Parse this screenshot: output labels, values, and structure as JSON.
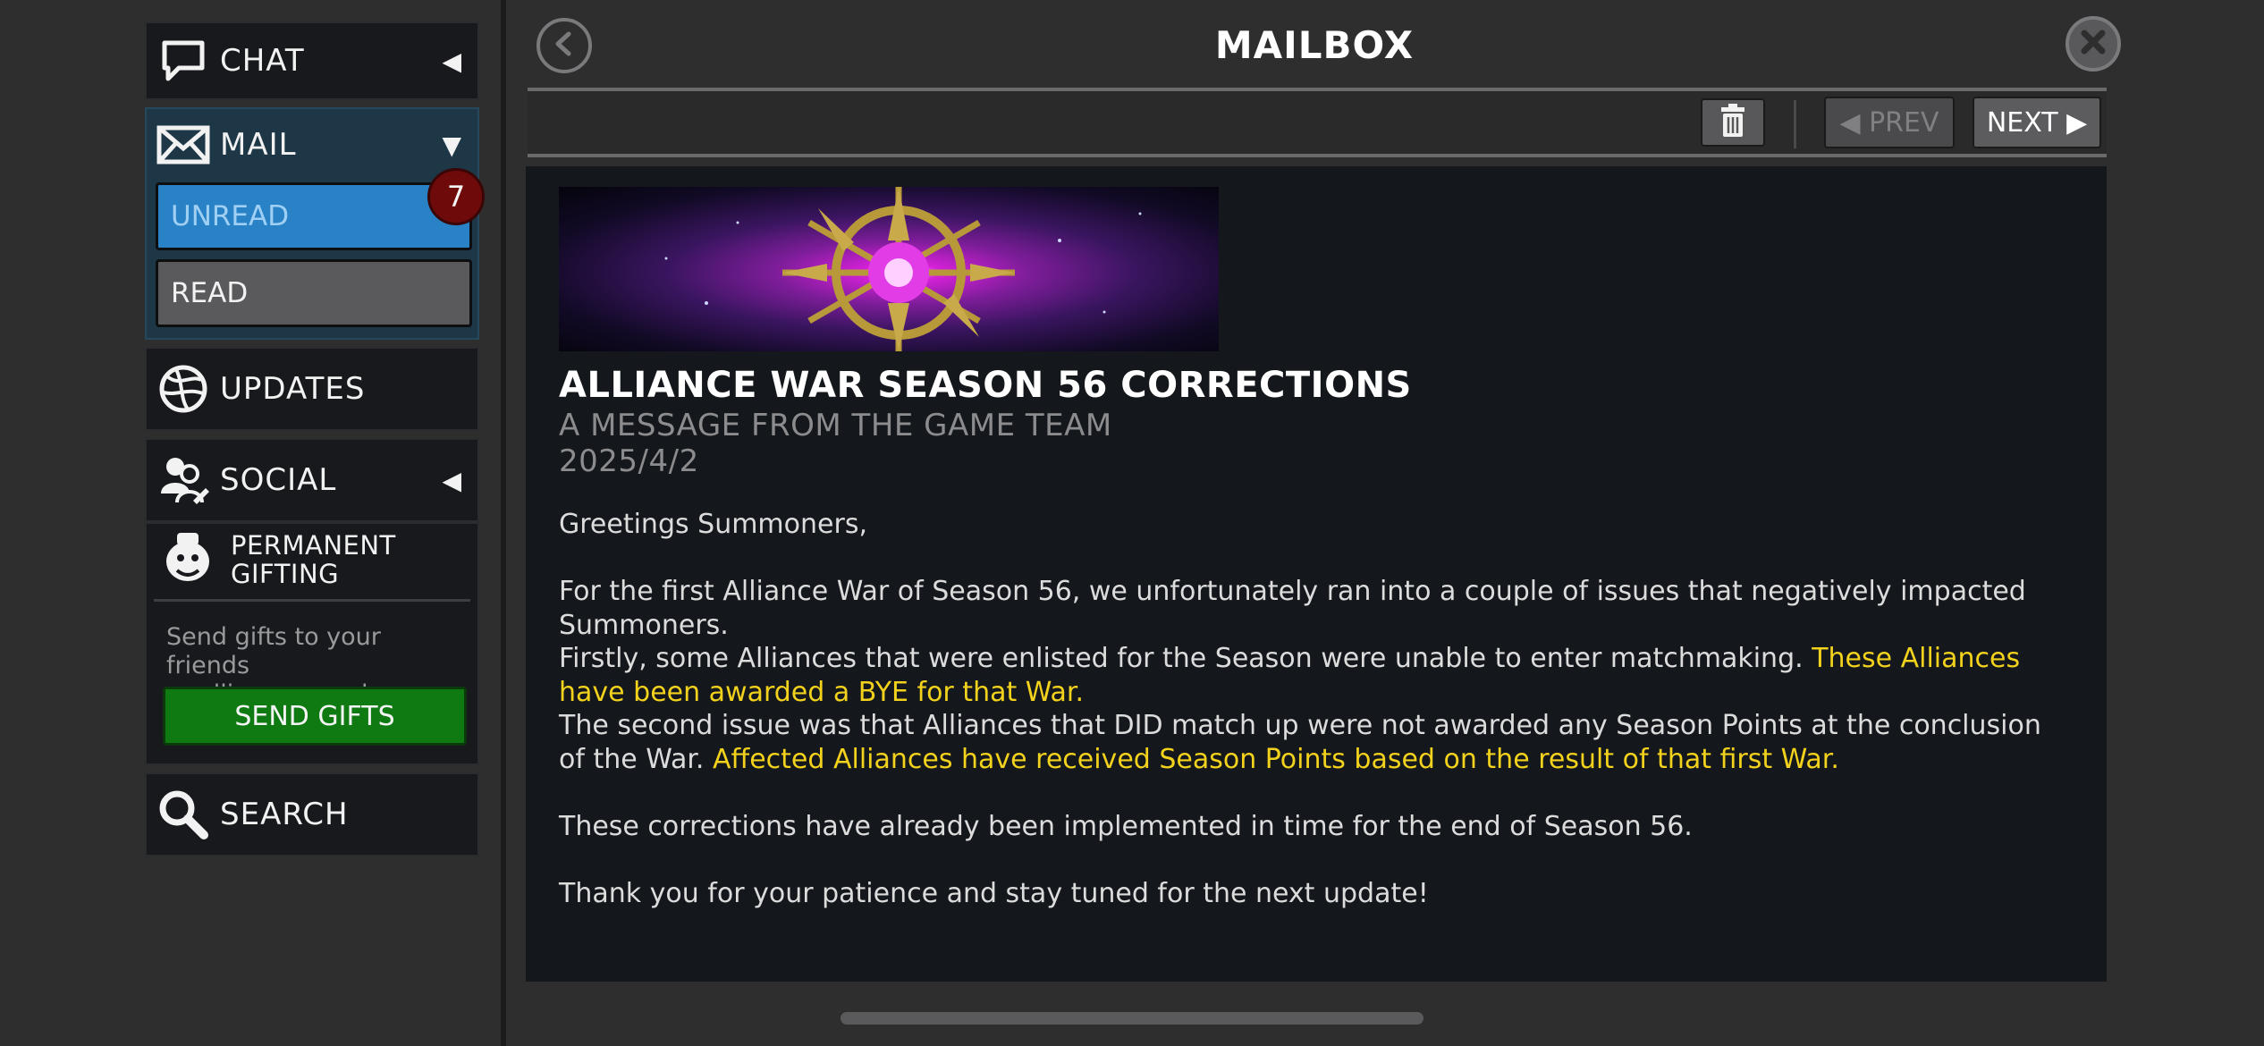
{
  "sidebar": {
    "chat": {
      "label": "CHAT",
      "icon": "chat-bubble-icon",
      "arrow": "◀"
    },
    "mail": {
      "label": "MAIL",
      "icon": "envelope-icon",
      "arrow": "▼",
      "unread_label": "UNREAD",
      "read_label": "READ",
      "unread_count": "7"
    },
    "updates": {
      "label": "UPDATES",
      "icon": "globe-icon"
    },
    "social": {
      "label": "SOCIAL",
      "icon": "people-icon",
      "arrow": "◀"
    },
    "gifting": {
      "title_line1": "PERMANENT",
      "title_line2": "GIFTING",
      "icon": "gift-character-icon",
      "description_line1": "Send gifts to your friends",
      "description_line2": "or alliance members.",
      "send_label": "SEND GIFTS"
    },
    "search": {
      "label": "SEARCH",
      "icon": "magnifier-icon"
    }
  },
  "header": {
    "title": "MAILBOX",
    "back_icon": "back-arrow-icon",
    "close_icon": "close-icon"
  },
  "toolbar": {
    "delete_icon": "trash-icon",
    "prev_label": "◀ PREV",
    "next_label": "NEXT ▶"
  },
  "message": {
    "title": "ALLIANCE WAR SEASON 56 CORRECTIONS",
    "from": "A MESSAGE FROM THE GAME TEAM",
    "date": "2025/4/2",
    "greeting": "Greetings Summoners,",
    "para1": "For the first Alliance War of Season 56, we unfortunately ran into a couple of issues that negatively impacted Summoners.",
    "para2_plain": "Firstly, some Alliances that were enlisted for the Season were unable to enter matchmaking. ",
    "para2_highlight": "These Alliances have been awarded a BYE for that War.",
    "para3_plain": "The second issue was that Alliances that DID match up were not awarded any Season Points at the conclusion of the War. ",
    "para3_highlight": "Affected Alliances have received Season Points based on the result of that first War.",
    "para4": "These corrections have already been implemented in time for the end of Season 56.",
    "para5": "Thank you for your patience and stay tuned for the next update!"
  },
  "colors": {
    "highlight": "#f2d21c",
    "unread_blue": "#2a82c6",
    "badge_red": "#6e0a0a",
    "send_green": "#0f7a12"
  }
}
